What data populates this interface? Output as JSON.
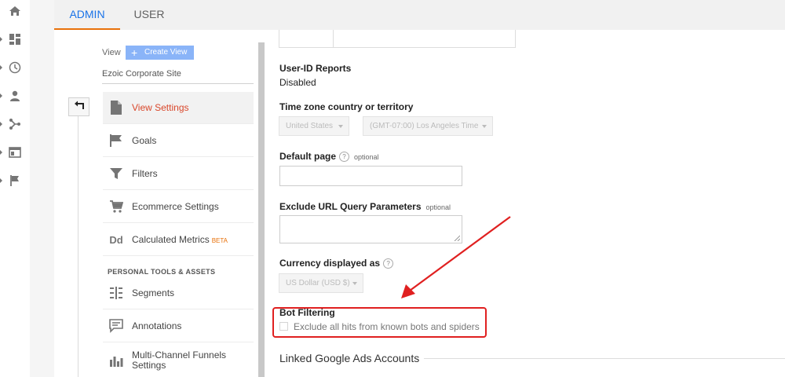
{
  "rail": {
    "icons": [
      "home-icon",
      "dashboards-icon",
      "clock-icon",
      "person-icon",
      "acquisition-icon",
      "behavior-icon",
      "flag-icon"
    ]
  },
  "tabs": {
    "admin": "ADMIN",
    "user": "USER"
  },
  "leftpanel": {
    "view_label": "View",
    "create_view": "Create View",
    "site_name": "Ezoic Corporate Site",
    "items": [
      {
        "label": "View Settings"
      },
      {
        "label": "Goals"
      },
      {
        "label": "Filters"
      },
      {
        "label": "Ecommerce Settings"
      },
      {
        "label": "Calculated Metrics",
        "badge": "BETA"
      }
    ],
    "section_header": "PERSONAL TOOLS & ASSETS",
    "tools": [
      {
        "label": "Segments"
      },
      {
        "label": "Annotations"
      },
      {
        "label": "Multi-Channel Funnels",
        "label2": "Settings"
      }
    ]
  },
  "main": {
    "user_id_reports": {
      "label": "User-ID Reports",
      "value": "Disabled"
    },
    "timezone": {
      "label": "Time zone country or territory",
      "country": "United States",
      "zone": "(GMT-07:00) Los Angeles Time"
    },
    "default_page": {
      "label": "Default page",
      "optional": "optional",
      "help": "?",
      "value": ""
    },
    "exclude_params": {
      "label": "Exclude URL Query Parameters",
      "optional": "optional",
      "value": ""
    },
    "currency": {
      "label": "Currency displayed as",
      "help": "?",
      "value": "US Dollar (USD $)"
    },
    "bot_filtering": {
      "label": "Bot Filtering",
      "checkbox_label": "Exclude all hits from known bots and spiders",
      "checked": false
    },
    "linked_ads": {
      "label": "Linked Google Ads Accounts"
    }
  },
  "colors": {
    "accent_blue": "#1a73e8",
    "active_red": "#d9472b",
    "annotation_red": "#e02020",
    "tab_underline": "#e8710a"
  }
}
